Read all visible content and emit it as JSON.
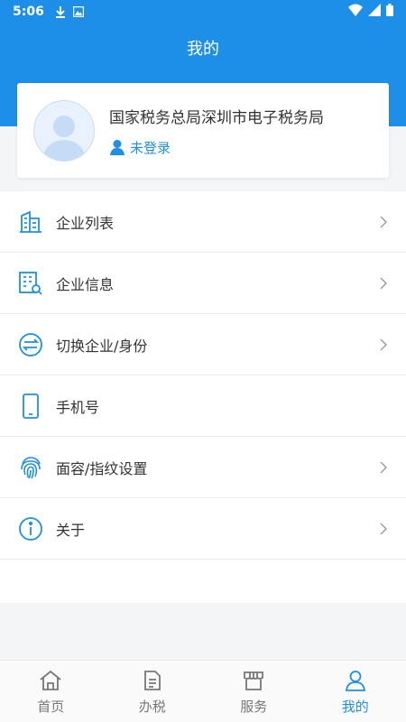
{
  "status_bar": {
    "time": "5:06",
    "icons": [
      "download-icon",
      "image-icon",
      "wifi-icon",
      "signal-icon",
      "battery-icon"
    ]
  },
  "header": {
    "title": "我的",
    "color": "#1e8fe8"
  },
  "profile": {
    "org_name": "国家税务总局深圳市电子税务局",
    "login_status": "未登录",
    "icons": [
      "avatar-icon",
      "person-icon"
    ]
  },
  "menu": {
    "items": [
      {
        "label": "企业列表",
        "icon": "building-icon",
        "has_chevron": true
      },
      {
        "label": "企业信息",
        "icon": "company-info-icon",
        "has_chevron": true
      },
      {
        "label": "切换企业/身份",
        "icon": "switch-icon",
        "has_chevron": true
      },
      {
        "label": "手机号",
        "icon": "phone-icon",
        "has_chevron": false
      },
      {
        "label": "面容/指纹设置",
        "icon": "fingerprint-icon",
        "has_chevron": true
      },
      {
        "label": "关于",
        "icon": "info-icon",
        "has_chevron": true
      }
    ]
  },
  "tabbar": {
    "tabs": [
      {
        "label": "首页",
        "icon": "home-icon",
        "active": false
      },
      {
        "label": "办税",
        "icon": "document-icon",
        "active": false
      },
      {
        "label": "服务",
        "icon": "store-icon",
        "active": false
      },
      {
        "label": "我的",
        "icon": "user-icon",
        "active": true
      }
    ],
    "active_color": "#1e8fe8",
    "inactive_color": "#777777"
  }
}
